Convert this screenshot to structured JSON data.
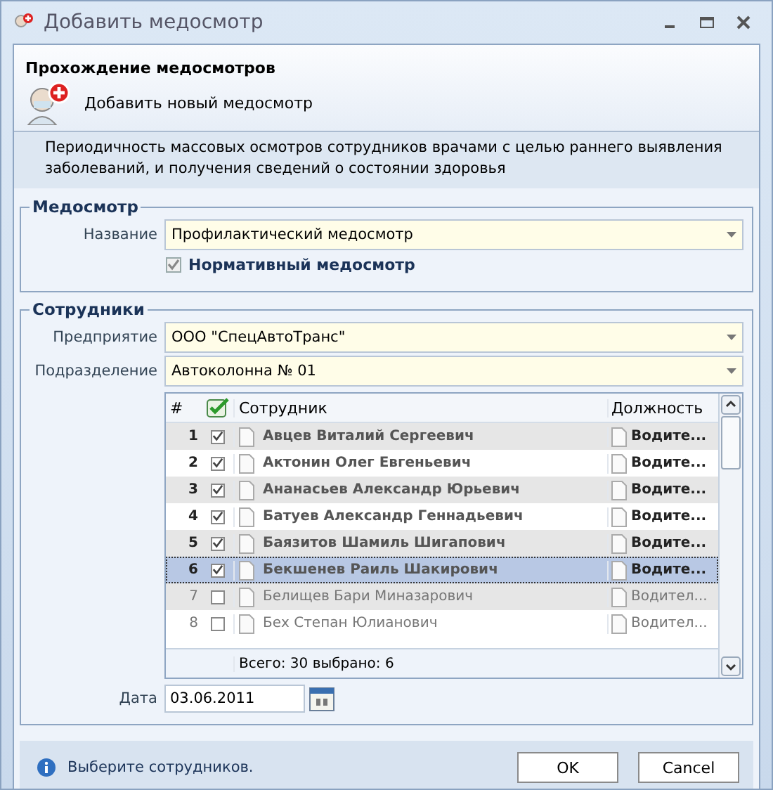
{
  "window": {
    "title": "Добавить медосмотр"
  },
  "header": {
    "title": "Прохождение медосмотров",
    "subtitle": "Добавить новый медосмотр",
    "description": "Периодичность массовых осмотров сотрудников врачами с целью раннего выявления заболеваний, и получения сведений о состоянии здоровья"
  },
  "exam_group": {
    "legend": "Медосмотр",
    "name_label": "Название",
    "name_value": "Профилактический медосмотр",
    "normative": {
      "label": "Нормативный медосмотр",
      "checked": true
    }
  },
  "staff_group": {
    "legend": "Сотрудники",
    "company_label": "Предприятие",
    "company_value": "ООО \"СпецАвтоТранс\"",
    "division_label": "Подразделение",
    "division_value": "Автоколонна № 01",
    "grid": {
      "columns": [
        "#",
        "Сотрудник",
        "Должность"
      ],
      "rows": [
        {
          "num": "1",
          "checked": true,
          "selected": false,
          "name": "Авцев Виталий Сергеевич",
          "position": "Водите..."
        },
        {
          "num": "2",
          "checked": true,
          "selected": false,
          "name": "Актонин Олег Евгеньевич",
          "position": "Водите..."
        },
        {
          "num": "3",
          "checked": true,
          "selected": false,
          "name": "Ананасьев Александр Юрьевич",
          "position": "Водите..."
        },
        {
          "num": "4",
          "checked": true,
          "selected": false,
          "name": "Батуев Александр Геннадьевич",
          "position": "Водите..."
        },
        {
          "num": "5",
          "checked": true,
          "selected": false,
          "name": "Баязитов Шамиль Шигапович",
          "position": "Водите..."
        },
        {
          "num": "6",
          "checked": true,
          "selected": true,
          "name": "Бекшенев Раиль Шакирович",
          "position": "Водите..."
        },
        {
          "num": "7",
          "checked": false,
          "selected": false,
          "name": "Белищев Бари Миназарович",
          "position": "Водител..."
        },
        {
          "num": "8",
          "checked": false,
          "selected": false,
          "name": "Бех Степан Юлианович",
          "position": "Водител..."
        }
      ],
      "summary": "Всего: 30  выбрано: 6"
    },
    "date_label": "Дата",
    "date_value": "03.06.2011"
  },
  "footer": {
    "message": "Выберите сотрудников.",
    "buttons": [
      "OK",
      "Cancel"
    ]
  }
}
